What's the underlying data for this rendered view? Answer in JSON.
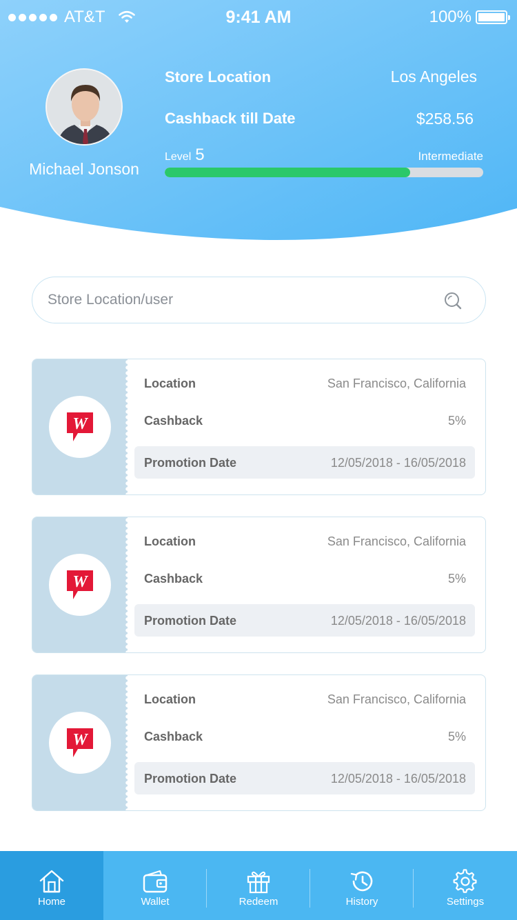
{
  "status_bar": {
    "carrier": "AT&T",
    "time": "9:41 AM",
    "battery": "100%"
  },
  "colors": {
    "header_gradient_start": "#8ed1fb",
    "header_gradient_end": "#4fb6f6",
    "progress_fill": "#2bc86a",
    "nav_bg": "#4bb7f2",
    "nav_active": "#2a9de0",
    "brand_red": "#e31837"
  },
  "profile": {
    "name": "Michael Jonson",
    "store_location_label": "Store Location",
    "store_location_value": "Los Angeles",
    "cashback_label": "Cashback till Date",
    "cashback_value": "$258.56",
    "level_label": "Level",
    "level_value": "5",
    "level_tier": "Intermediate",
    "level_progress_percent": 77
  },
  "search": {
    "placeholder": "Store Location/user",
    "icon": "search-icon"
  },
  "cards": [
    {
      "logo_icon": "walgreens-logo-icon",
      "location_label": "Location",
      "location_value": "San Francisco, California",
      "cashback_label": "Cashback",
      "cashback_value": "5%",
      "promotion_label": "Promotion Date",
      "promotion_value": "12/05/2018 - 16/05/2018"
    },
    {
      "logo_icon": "walgreens-logo-icon",
      "location_label": "Location",
      "location_value": "San Francisco, California",
      "cashback_label": "Cashback",
      "cashback_value": "5%",
      "promotion_label": "Promotion Date",
      "promotion_value": "12/05/2018 - 16/05/2018"
    },
    {
      "logo_icon": "walgreens-logo-icon",
      "location_label": "Location",
      "location_value": "San Francisco, California",
      "cashback_label": "Cashback",
      "cashback_value": "5%",
      "promotion_label": "Promotion Date",
      "promotion_value": "12/05/2018 - 16/05/2018"
    }
  ],
  "nav": [
    {
      "label": "Home",
      "icon": "home-icon",
      "active": true
    },
    {
      "label": "Wallet",
      "icon": "wallet-icon",
      "active": false
    },
    {
      "label": "Redeem",
      "icon": "gift-icon",
      "active": false
    },
    {
      "label": "History",
      "icon": "history-icon",
      "active": false
    },
    {
      "label": "Settings",
      "icon": "gear-icon",
      "active": false
    }
  ]
}
